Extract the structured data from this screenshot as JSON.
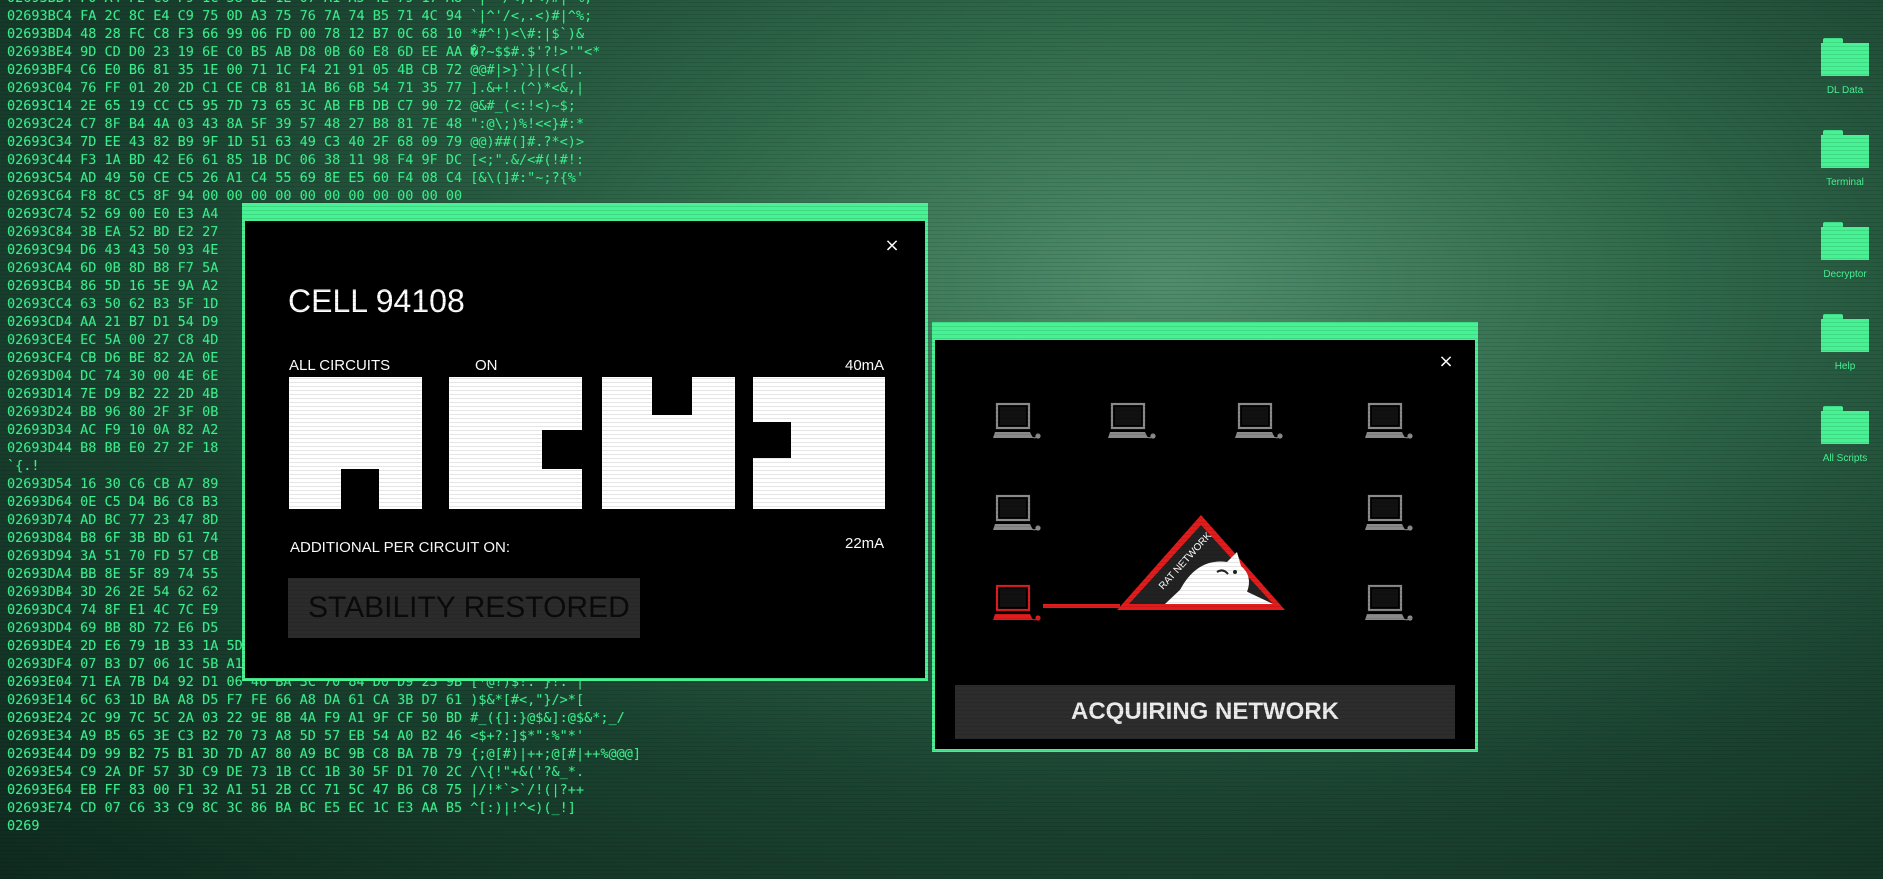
{
  "hex_lines": [
    "02693BB4 F0 A4 F2 C6 F9 1C 58 B2 1E 07 A1 A5 4E 79 17 A8 `|^'/<,.<)#|^%;",
    "02693BC4 FA 2C 8C E4 C9 75 0D A3 75 76 7A 74 B5 71 4C 94 `|^'/<,.<)#|^%;",
    "02693BD4 48 28 FC C8 F3 66 99 06 FD 00 78 12 B7 0C 68 10 *#^!)<\\#:|$`)&",
    "02693BE4 9D CD D0 23 19 6E C0 B5 AB D8 0B 60 E8 6D EE AA �?~$$#.$'?!>'\"<*",
    "02693BF4 C6 E0 B6 81 35 1E 00 71 1C F4 21 91 05 4B CB 72 @@#|>}`}|(<{|.",
    "02693C04 76 FF 01 20 2D C1 CE CB 81 1A B6 6B 54 71 35 77 ].&+!.(^)*<&,|",
    "02693C14 2E 65 19 CC C5 95 7D 73 65 3C AB FB DB C7 90 72 @&#_(<:!<)~$;",
    "02693C24 C7 8F B4 4A 03 43 8A 5F 39 57 48 27 B8 81 7E 48 \":@\\;)%!<<}#:*",
    "02693C34 7D EE 43 82 B9 9F 1D 51 63 49 C3 40 2F 68 09 79 @@)##(]#.?*<)>",
    "02693C44 F3 1A BD 42 E6 61 85 1B DC 06 38 11 98 F4 9F DC [<;\".&/<#(!#!:",
    "02693C54 AD 49 50 CE C5 26 A1 C4 55 69 8E E5 60 F4 08 C4 [&\\(]#:\"~;?{%'",
    "02693C64 F8 8C C5 8F 94 00 00 00 00 00 00 00 00 00 00 00",
    "02693C74 52 69 00 E0 E3 A4",
    "02693C84 3B EA 52 BD E2 27",
    "02693C94 D6 43 43 50 93 4E",
    "02693CA4 6D 0B 8D B8 F7 5A",
    "02693CB4 86 5D 16 5E 9A A2",
    "02693CC4 63 50 62 B3 5F 1D",
    "02693CD4 AA 21 B7 D1 54 D9",
    "02693CE4 EC 5A 00 27 C8 4D",
    "02693CF4 CB D6 BE 82 2A 0E",
    "02693D04 DC 74 30 00 4E 6E",
    "02693D14 7E D9 B2 22 2D 4B",
    "02693D24 BB 96 80 2F 3F 0B",
    "02693D34 AC F9 10 0A 82 A2",
    "02693D44 B8 BB E0 27 2F 18",
    "`{.!",
    "02693D54 16 30 C6 CB A7 89",
    "02693D64 0E C5 D4 B6 C8 B3",
    "02693D74 AD BC 77 23 47 8D",
    "02693D84 B8 6F 3B BD 61 74",
    "02693D94 3A 51 70 FD 57 CB",
    "02693DA4 BB 8E 5F 89 74 55",
    "02693DB4 3D 26 2E 54 62 62",
    "02693DC4 74 8F E1 4C 7C E9",
    "02693DD4 69 BB 8D 72 E6 D5",
    "02693DE4 2D E6 79 1B 33 1A 5D 46 98 B7 6D 34 AC 7B E9 91 }z\")@@|+^}#:!&",
    "02693DF4 07 B3 D7 06 1C 5B A1 A7 76 39 B7 D3 1B E0 B1 4C $,<+`~{*#^$)`%",
    "02693E04 71 EA 7B D4 92 D1 06 46 BA 3C 70 84 D0 D9 23 9B [*@?)$!:'}!.^|",
    "02693E14 6C 63 1D BA A8 D5 F7 FE 66 A8 DA 61 CA 3B D7 61 )$&*[#<,\"}/>*[",
    "02693E24 2C 99 7C 5C 2A 03 22 9E 8B 4A F9 A1 9F CF 50 BD #_({]:}@$&]:@$&*;_/",
    "02693E34 A9 B5 65 3E C3 B2 70 73 A8 5D 57 EB 54 A0 B2 46 <$+?:]$*\":%\"*'",
    "02693E44 D9 99 B2 75 B1 3D 7D A7 80 A9 BC 9B C8 BA 7B 79 {;@[#)|++;@[#|++%@@@]",
    "02693E54 C9 2A DF 57 3D C9 DE 73 1B CC 1B 30 5F D1 70 2C /\\{!\"+&('?&_*.",
    "02693E64 EB FF 83 00 F1 32 A1 51 2B CC 71 5C 47 B6 C8 75 |/!*`>`/!(|?++",
    "02693E74 CD 07 C6 33 C9 8C 3C 86 BA BC E5 EC 1C E3 AA B5 ^[:)|!^<)(_!]",
    "0269"
  ],
  "cell_window": {
    "close": "×",
    "title": "CELL 94108",
    "all_circuits_label": "ALL CIRCUITS",
    "all_circuits_state": "ON",
    "all_circuits_current": "40mA",
    "additional_label": "ADDITIONAL PER CIRCUIT ON:",
    "additional_current": "22mA",
    "status_button": "STABILITY RESTORED"
  },
  "network_window": {
    "close": "×",
    "rat_label": "RAT NETWORK",
    "button": "ACQUIRING NETWORK",
    "active_node_color": "#e31b1b",
    "inactive_node_color": "#8a8a8a"
  },
  "desktop_icons": [
    {
      "label": "DL Data",
      "icon": "folder-icon"
    },
    {
      "label": "Terminal",
      "icon": "folder-icon"
    },
    {
      "label": "Decryptor",
      "icon": "folder-icon"
    },
    {
      "label": "Help",
      "icon": "folder-icon"
    },
    {
      "label": "All Scripts",
      "icon": "folder-icon"
    }
  ],
  "colors": {
    "accent": "#46f293",
    "hex_text": "#3df08e",
    "alert": "#e31b1b"
  }
}
